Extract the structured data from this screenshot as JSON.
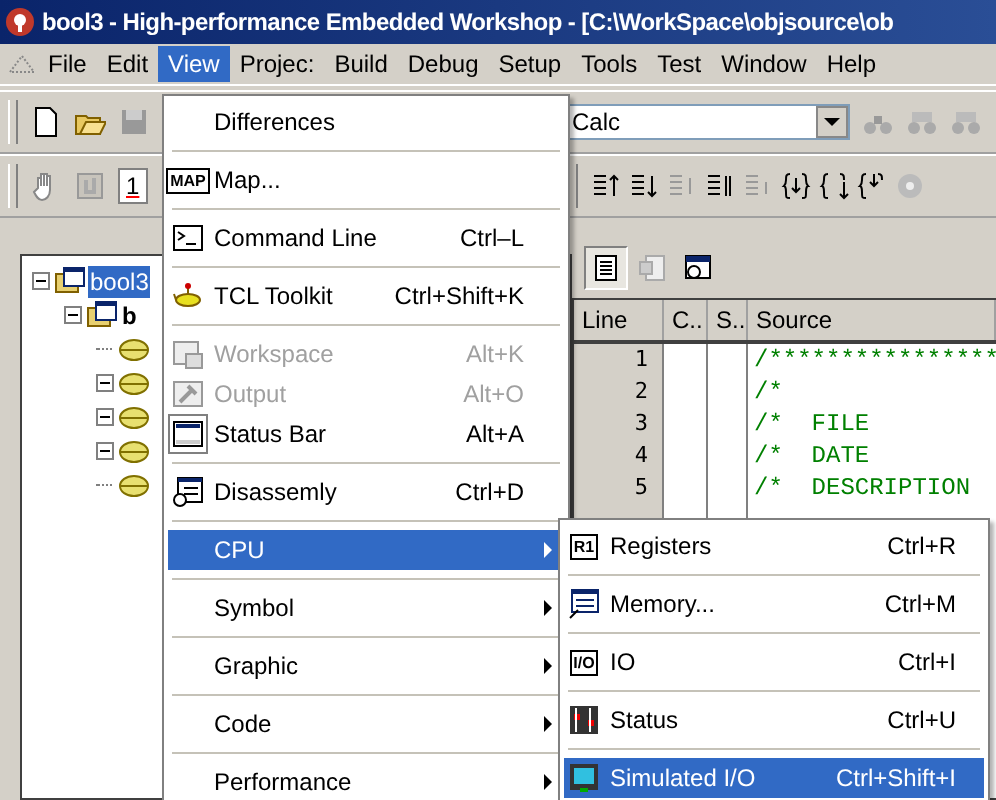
{
  "window": {
    "title": "bool3 - High-performance Embedded Workshop - [C:\\WorkSpace\\objsource\\ob"
  },
  "menu_bar": [
    {
      "label": "File",
      "selected": false
    },
    {
      "label": "Edit",
      "selected": false
    },
    {
      "label": "View",
      "selected": true
    },
    {
      "label": "Projec:",
      "selected": false
    },
    {
      "label": "Build",
      "selected": false
    },
    {
      "label": "Debug",
      "selected": false
    },
    {
      "label": "Setup",
      "selected": false
    },
    {
      "label": "Tools",
      "selected": false
    },
    {
      "label": "Test",
      "selected": false
    },
    {
      "label": "Window",
      "selected": false
    },
    {
      "label": "Help",
      "selected": false
    }
  ],
  "toolbar": {
    "combo_value": "Calc",
    "field_value": "1"
  },
  "tree": [
    {
      "label": "bool3",
      "selected": true,
      "expanded": true,
      "children": [
        {
          "label": "b",
          "selected": false,
          "expanded": true,
          "children": [
            {
              "kind": "leaf"
            },
            {
              "kind": "node",
              "expanded": true
            },
            {
              "kind": "node",
              "expanded": true
            },
            {
              "kind": "node",
              "expanded": true
            },
            {
              "kind": "leaf"
            }
          ]
        }
      ]
    }
  ],
  "editor": {
    "columns": [
      "Line",
      "C..",
      "S..",
      "Source"
    ],
    "rows": [
      {
        "line": "1",
        "source": "/****************"
      },
      {
        "line": "2",
        "source": "/*"
      },
      {
        "line": "3",
        "source": "/*  FILE"
      },
      {
        "line": "4",
        "source": "/*  DATE"
      },
      {
        "line": "5",
        "source": "/*  DESCRIPTION"
      }
    ]
  },
  "view_menu": [
    {
      "kind": "item",
      "label": "Differences",
      "selected": false,
      "disabled": false,
      "checked": false
    },
    {
      "kind": "separator"
    },
    {
      "kind": "item",
      "label": "Map...",
      "icon_text": "MAP",
      "selected": false,
      "disabled": false,
      "checked": false
    },
    {
      "kind": "separator"
    },
    {
      "kind": "item",
      "label": "Command Line",
      "shortcut": "Ctrl–L",
      "selected": false,
      "disabled": false,
      "checked": false
    },
    {
      "kind": "separator"
    },
    {
      "kind": "item",
      "label": "TCL Toolkit",
      "shortcut": "Ctrl+Shift+K",
      "selected": false,
      "disabled": false,
      "checked": false
    },
    {
      "kind": "separator"
    },
    {
      "kind": "item",
      "label": "Workspace",
      "shortcut": "Alt+K",
      "selected": false,
      "disabled": true,
      "checked": false
    },
    {
      "kind": "item",
      "label": "Output",
      "shortcut": "Alt+O",
      "selected": false,
      "disabled": true,
      "checked": false
    },
    {
      "kind": "item",
      "label": "Status Bar",
      "shortcut": "Alt+A",
      "selected": false,
      "disabled": false,
      "checked": true
    },
    {
      "kind": "separator"
    },
    {
      "kind": "item",
      "label": "Disassemly",
      "shortcut": "Ctrl+D",
      "selected": false,
      "disabled": false,
      "checked": false
    },
    {
      "kind": "separator"
    },
    {
      "kind": "submenu",
      "label": "CPU",
      "selected": true,
      "disabled": false,
      "checked": false
    },
    {
      "kind": "separator"
    },
    {
      "kind": "submenu",
      "label": "Symbol",
      "selected": false,
      "disabled": false,
      "checked": false
    },
    {
      "kind": "separator"
    },
    {
      "kind": "submenu",
      "label": "Graphic",
      "selected": false,
      "disabled": false,
      "checked": false
    },
    {
      "kind": "separator"
    },
    {
      "kind": "submenu",
      "label": "Code",
      "selected": false,
      "disabled": false,
      "checked": false
    },
    {
      "kind": "separator"
    },
    {
      "kind": "submenu",
      "label": "Performance",
      "selected": false,
      "disabled": false,
      "checked": false
    }
  ],
  "cpu_submenu": [
    {
      "kind": "item",
      "label": "Registers",
      "icon_text": "R1",
      "shortcut": "Ctrl+R",
      "selected": false
    },
    {
      "kind": "separator"
    },
    {
      "kind": "item",
      "label": "Memory...",
      "shortcut": "Ctrl+M",
      "selected": false
    },
    {
      "kind": "separator"
    },
    {
      "kind": "item",
      "label": "IO",
      "icon_text": "I/O",
      "shortcut": "Ctrl+I",
      "selected": false
    },
    {
      "kind": "separator"
    },
    {
      "kind": "item",
      "label": "Status",
      "shortcut": "Ctrl+U",
      "selected": false
    },
    {
      "kind": "separator"
    },
    {
      "kind": "item",
      "label": "Simulated I/O",
      "shortcut": "Ctrl+Shift+I",
      "selected": true
    }
  ]
}
